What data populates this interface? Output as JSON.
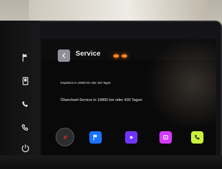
{
  "header": {
    "title": "Service"
  },
  "content": {
    "line_1": "Inspektion in 10800 km oder 420 Tagen",
    "line_2": "Ölwechsel-Service in 10800 km oder 420 Tagen"
  },
  "icons": {
    "left": [
      "flag-icon",
      "device-icon",
      "phone-icon",
      "phone-outline-icon",
      "power-icon"
    ],
    "dock": [
      "brand-icon",
      "flag-icon",
      "play-icon",
      "media-icon",
      "phone-icon"
    ]
  },
  "colors": {
    "accent_orange": "#ff8a2b",
    "dock_blue": "#1a73ff",
    "dock_purple": "#6f35ff",
    "dock_magenta": "#d23bff",
    "dock_lime": "#c9f23d"
  }
}
